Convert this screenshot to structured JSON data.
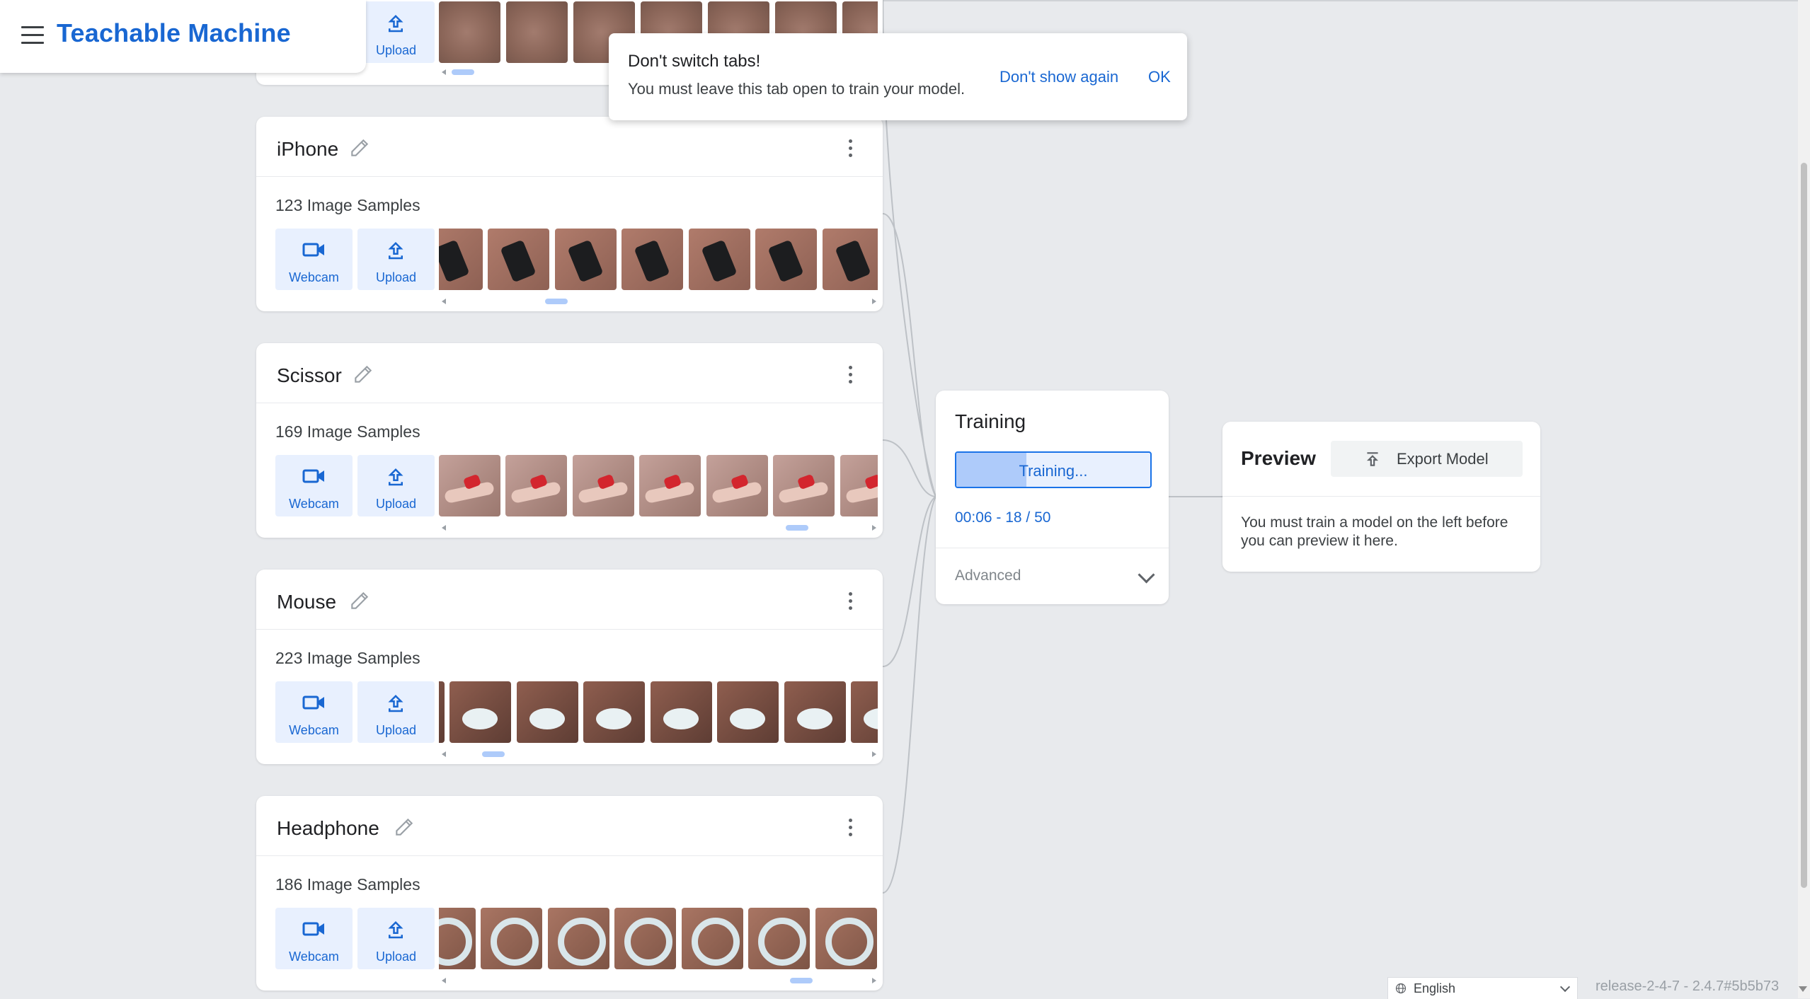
{
  "app": {
    "title": "Teachable Machine"
  },
  "toast": {
    "title": "Don't switch tabs!",
    "message": "You must leave this tab open to train your model.",
    "dont_show": "Don't show again",
    "ok": "OK"
  },
  "top_card": {
    "upload_label": "Upload"
  },
  "classes": [
    {
      "name": "iPhone",
      "samples": "123 Image Samples",
      "webcam": "Webcam",
      "upload": "Upload",
      "scroll_position": 0.24
    },
    {
      "name": "Scissor",
      "samples": "169 Image Samples",
      "webcam": "Webcam",
      "upload": "Upload",
      "scroll_position": 0.85
    },
    {
      "name": "Mouse",
      "samples": "223 Image Samples",
      "webcam": "Webcam",
      "upload": "Upload",
      "scroll_position": 0.08
    },
    {
      "name": "Headphone",
      "samples": "186 Image Samples",
      "webcam": "Webcam",
      "upload": "Upload",
      "scroll_position": 0.86
    }
  ],
  "training": {
    "title": "Training",
    "button_label": "Training...",
    "progress_fraction": 0.36,
    "status": "00:06 - 18 / 50",
    "advanced": "Advanced"
  },
  "preview": {
    "title": "Preview",
    "export_label": "Export Model",
    "message": "You must train a model on the left before you can preview it here."
  },
  "footer": {
    "language": "English",
    "release": "release-2-4-7 - 2.4.7#5b5b73"
  },
  "colors": {
    "brand": "#1967d2",
    "button_bg": "#e8f0fe",
    "background": "#e8eaed"
  }
}
